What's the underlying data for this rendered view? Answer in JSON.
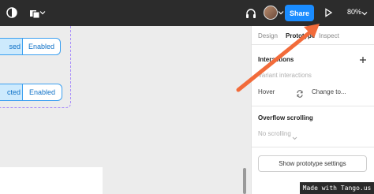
{
  "topbar": {
    "share_label": "Share",
    "zoom_label": "80%"
  },
  "canvas": {
    "row1": {
      "left_label": "sed",
      "right_label": "Enabled"
    },
    "row2": {
      "left_label": "cted",
      "right_label": "Enabled"
    }
  },
  "panel": {
    "tabs": [
      "Design",
      "Prototype",
      "Inspect"
    ],
    "interactions_title": "Interactions",
    "variant_interactions": "Variant interactions",
    "trigger": "Hover",
    "action": "Change to...",
    "overflow_title": "Overflow scrolling",
    "overflow_value": "No scrolling",
    "show_settings": "Show prototype settings"
  },
  "watermark": "Made with Tango.us",
  "colors": {
    "accent": "#1a8cff",
    "annotation_arrow": "#f26b3a",
    "variant_border": "#a78bfa"
  }
}
